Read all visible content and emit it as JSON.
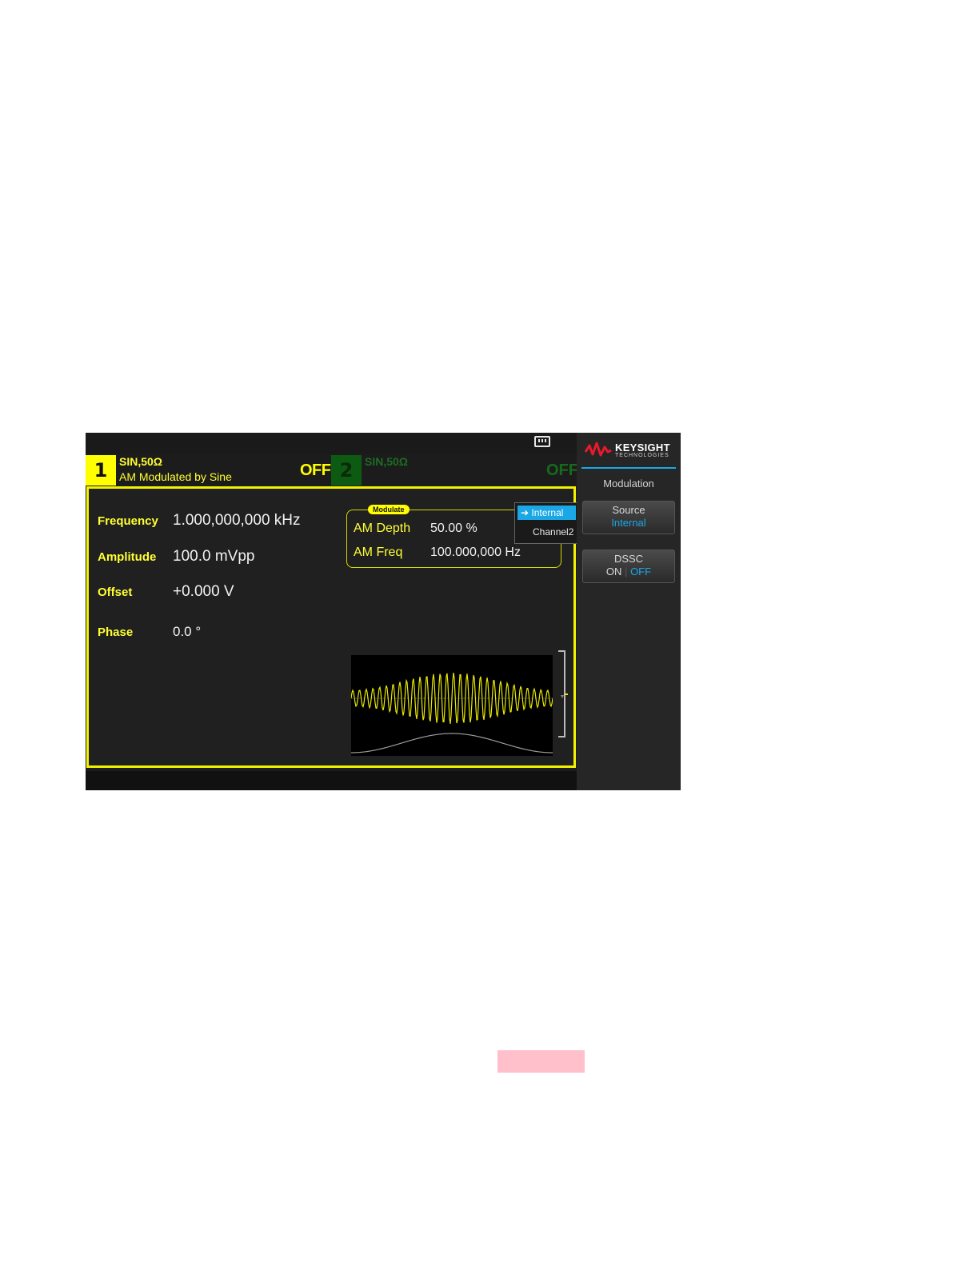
{
  "channel1": {
    "number": "1",
    "waveform": "SIN,50Ω",
    "description": "AM Modulated by Sine",
    "output_state": "OFF"
  },
  "channel2": {
    "number": "2",
    "waveform": "SIN,50Ω",
    "output_state": "OFF"
  },
  "params": {
    "frequency_label": "Frequency",
    "frequency_value": "1.000,000,000 kHz",
    "amplitude_label": "Amplitude",
    "amplitude_value": "100.0 mVpp",
    "offset_label": "Offset",
    "offset_value": "+0.000 V",
    "phase_label": "Phase",
    "phase_value": "0.0 °"
  },
  "modulation": {
    "tag": "Modulate",
    "depth_label": "AM Depth",
    "depth_value": "50.00 %",
    "freq_label": "AM Freq",
    "freq_value": "100.000,000 Hz"
  },
  "source_dropdown": {
    "selected": "Internal",
    "other": "Channel2"
  },
  "sidebar": {
    "brand": "KEYSIGHT",
    "brand_sub": "TECHNOLOGIES",
    "title": "Modulation",
    "softkeys": [
      {
        "top": "Source",
        "bottom": "Internal"
      },
      {
        "top": "DSSC",
        "on": "ON",
        "off": "OFF",
        "active": "OFF"
      }
    ]
  },
  "colors": {
    "ch1": "#ffff00",
    "ch2": "#0d5b12",
    "accent": "#1aa7e6"
  },
  "icons": {
    "lan": "lan-status-icon",
    "logo": "keysight-logo-icon"
  }
}
